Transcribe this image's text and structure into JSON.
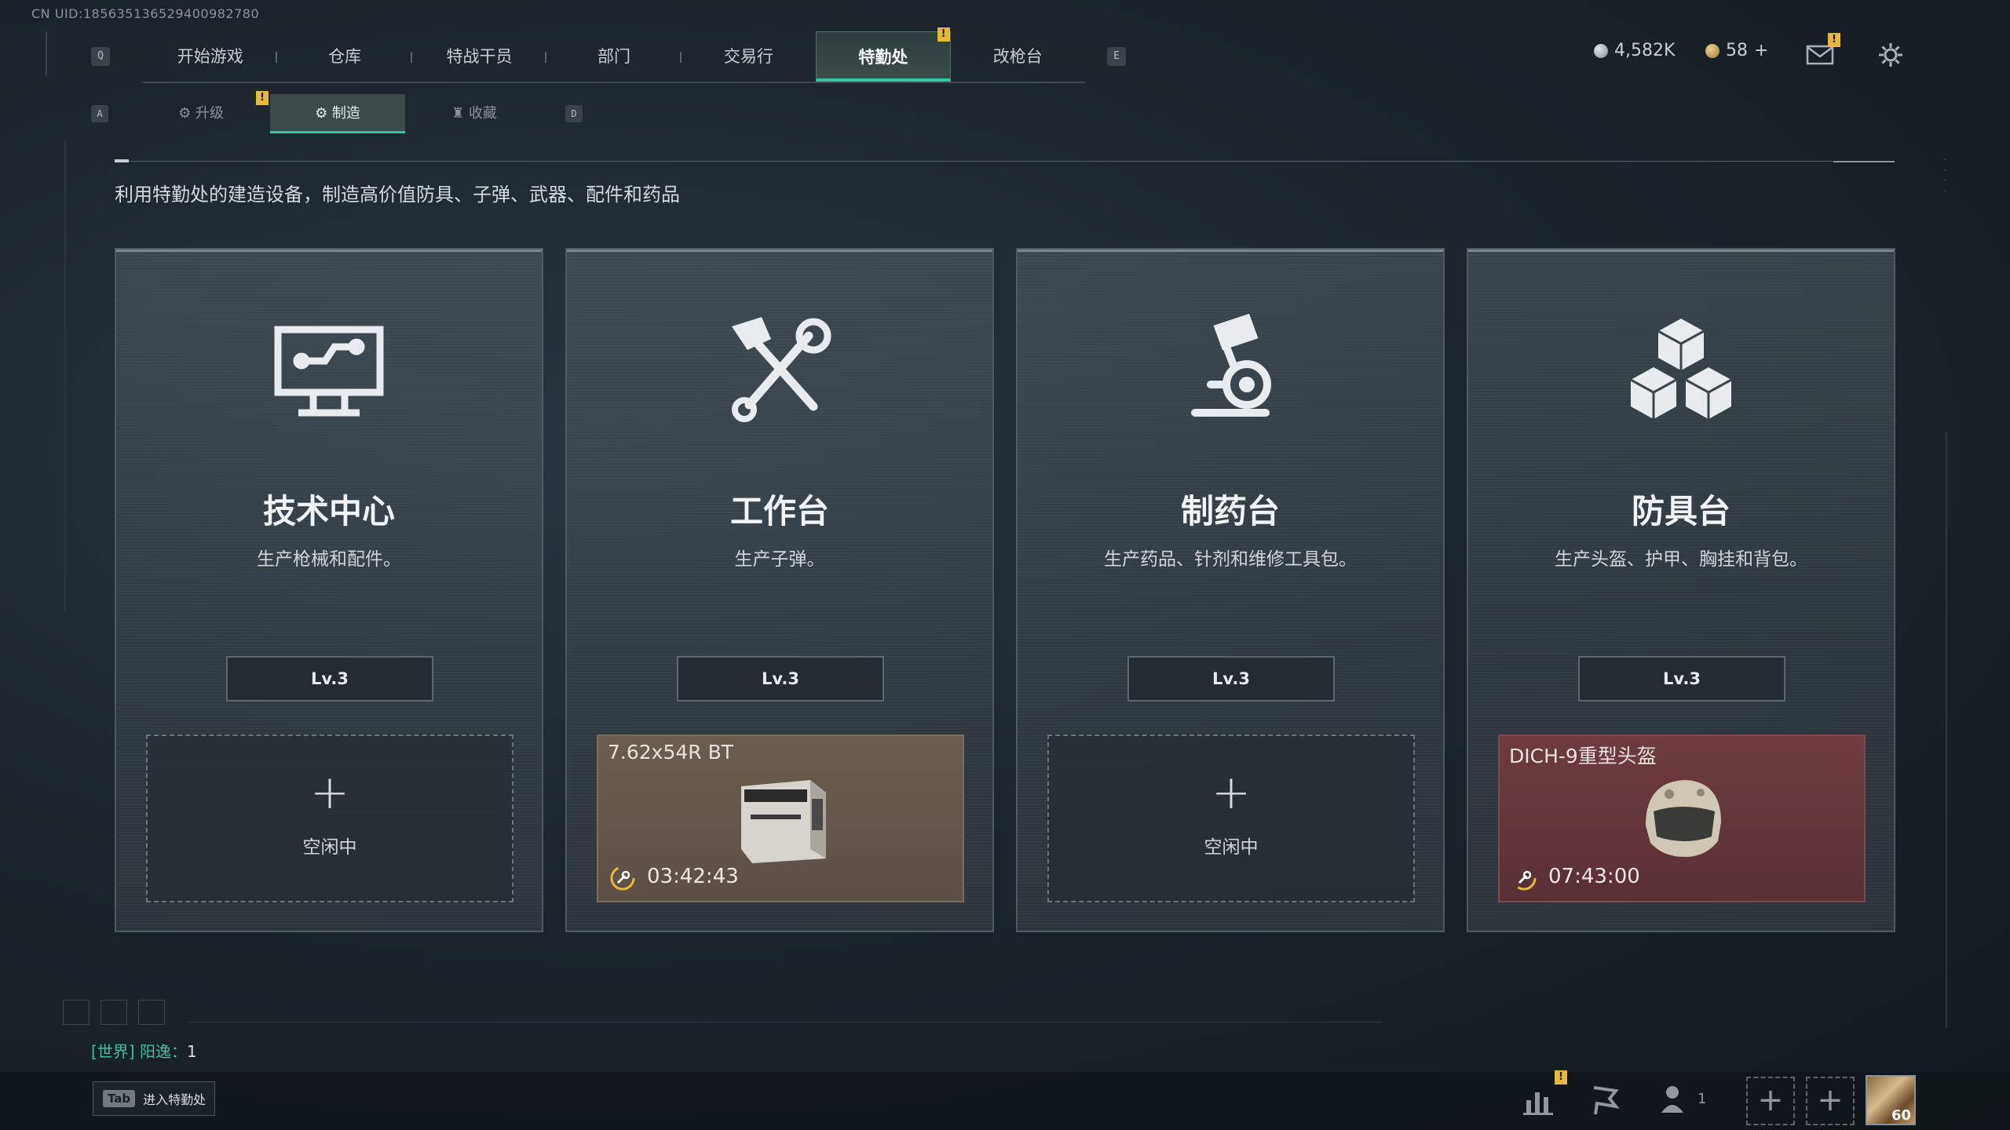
{
  "uid": "CN UID:1856351365294009827​80",
  "keys": {
    "left_nav": "Q",
    "right_nav": "E",
    "left_sub": "A",
    "right_sub": "D"
  },
  "nav": {
    "tabs": [
      {
        "label": "开始游戏"
      },
      {
        "label": "仓库"
      },
      {
        "label": "特战干员"
      },
      {
        "label": "部门"
      },
      {
        "label": "交易行"
      },
      {
        "label": "特勤处",
        "active": true,
        "alert": "!"
      },
      {
        "label": "改枪台"
      }
    ]
  },
  "currency": {
    "silver": "4,582K",
    "gold": "58",
    "gold_add": "+",
    "mail_alert": "!"
  },
  "subtabs": [
    {
      "label": "升级",
      "alert": "!"
    },
    {
      "label": "制造",
      "active": true
    },
    {
      "label": "收藏"
    }
  ],
  "description": "利用特勤处的建造设备，制造高价值防具、子弹、武器、配件和药品",
  "cards": [
    {
      "icon": "computer-icon",
      "title": "技术中心",
      "subtitle": "生产枪械和配件。",
      "level": "Lv.3",
      "slot": {
        "state": "empty",
        "plus": "+",
        "label": "空闲中"
      }
    },
    {
      "icon": "hammer-wrench-icon",
      "title": "工作台",
      "subtitle": "生产子弹。",
      "level": "Lv.3",
      "slot": {
        "state": "producing",
        "item": "7.62x54R BT",
        "timer": "03:42:43",
        "item_icon": "ammo-box-icon"
      }
    },
    {
      "icon": "microscope-icon",
      "title": "制药台",
      "subtitle": "生产药品、针剂和维修工具包。",
      "level": "Lv.3",
      "slot": {
        "state": "empty",
        "plus": "+",
        "label": "空闲中"
      }
    },
    {
      "icon": "armor-cubes-icon",
      "title": "防具台",
      "subtitle": "生产头盔、护甲、胸挂和背包。",
      "level": "Lv.3",
      "slot": {
        "state": "producing",
        "item": "DICH-9重型头盔",
        "timer": "07:43:00",
        "item_icon": "helmet-icon"
      }
    }
  ],
  "chat": {
    "channel": "[世界] 阳逸：",
    "count": "1"
  },
  "bottom": {
    "tab_key": "Tab",
    "tab_hint": "进入特勤处",
    "stats_alert": "!",
    "squad_count": "1",
    "avatar_level": "60",
    "add": "+"
  },
  "colors": {
    "accent": "#37c4a0",
    "alert": "#e8b83a",
    "prod_brown": "#6b5d4f",
    "prod_red": "#6d3b40"
  }
}
